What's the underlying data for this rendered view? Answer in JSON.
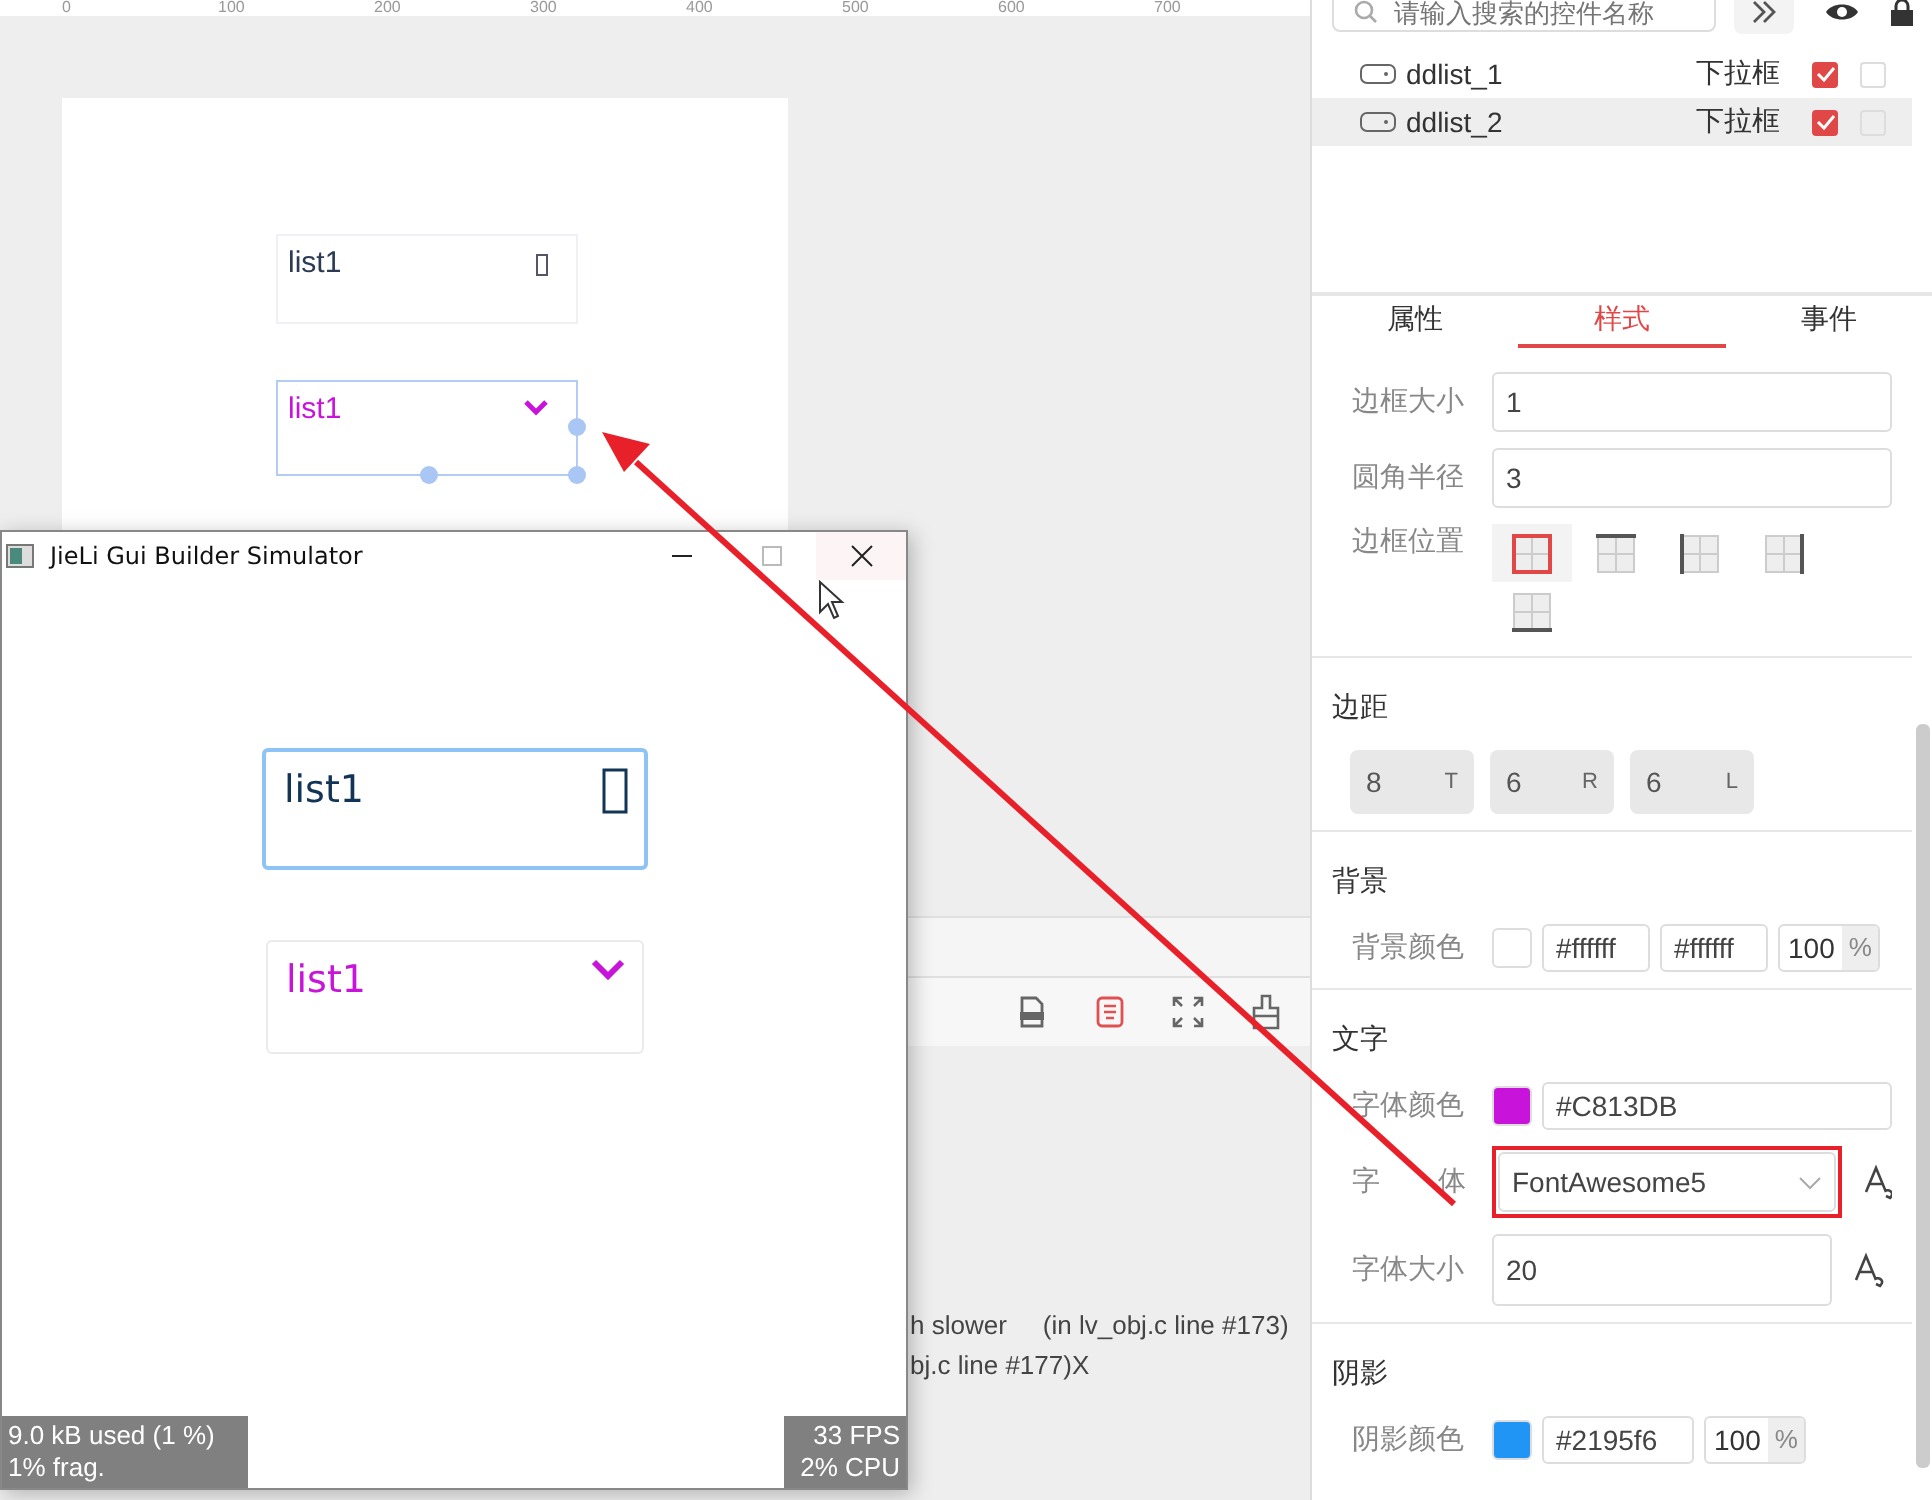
{
  "ruler": {
    "ticks": [
      "0",
      "100",
      "200",
      "300",
      "400",
      "500",
      "600",
      "700"
    ]
  },
  "canvas": {
    "widgets": [
      {
        "text": "list1",
        "kind": "box",
        "selected": false
      },
      {
        "text": "list1",
        "kind": "chevron",
        "selected": true
      }
    ]
  },
  "toolbar": [
    {
      "selected": false
    },
    {
      "selected": true
    },
    {
      "selected": false
    },
    {
      "selected": false
    }
  ],
  "log": {
    "lines": [
      [
        "h slower",
        "(in lv_obj.c line #173)"
      ],
      [
        "bj.c line #177)X"
      ]
    ]
  },
  "simulator": {
    "title": "JieLi Gui Builder Simulator",
    "widgets": [
      {
        "text": "list1",
        "kind": "box",
        "focused": true
      },
      {
        "text": "list1",
        "kind": "chevron",
        "focused": false
      }
    ],
    "stats_left": [
      "9.0 kB used (1 %)",
      "1% frag."
    ],
    "stats_right": [
      "33 FPS",
      "2% CPU"
    ]
  },
  "panel": {
    "search": {
      "placeholder": "请输入搜索的控件名称"
    },
    "widgets": [
      {
        "name": "ddlist_1",
        "type": "下拉框",
        "visible": true,
        "locked": false,
        "selected": false
      },
      {
        "name": "ddlist_2",
        "type": "下拉框",
        "visible": true,
        "locked": false,
        "selected": true
      }
    ],
    "tabs": [
      {
        "label": "属性",
        "selected": false
      },
      {
        "label": "样式",
        "selected": true
      },
      {
        "label": "事件",
        "selected": false
      }
    ],
    "border_size": {
      "label": "边框大小",
      "value": "1"
    },
    "radius": {
      "label": "圆角半径",
      "value": "3"
    },
    "border_position": {
      "label": "边框位置",
      "options": [
        {
          "kind": "all",
          "selected": true
        },
        {
          "kind": "top",
          "selected": false
        },
        {
          "kind": "left",
          "selected": false
        },
        {
          "kind": "right",
          "selected": false
        },
        {
          "kind": "bottom",
          "selected": false
        }
      ]
    },
    "padding": {
      "heading": "边距",
      "items": [
        {
          "value": "8",
          "side": "T"
        },
        {
          "value": "6",
          "side": "R"
        },
        {
          "value": "6",
          "side": "L"
        }
      ]
    },
    "background": {
      "heading": "背景",
      "label": "背景颜色",
      "color": "#ffffff",
      "value": "#ffffff",
      "value_2": "#ffffff",
      "opacity": "100",
      "unit": "%"
    },
    "text": {
      "heading": "文字",
      "color_label": "字体颜色",
      "color": "#c813db",
      "color_value": "#C813DB",
      "font_label": [
        "字",
        "体"
      ],
      "font": "FontAwesome5",
      "size_label": "字体大小",
      "size": "20"
    },
    "shadow": {
      "heading": "阴影",
      "label": "阴影颜色",
      "color": "#2195f6",
      "value": "#2195f6",
      "opacity": "100",
      "unit": "%"
    }
  }
}
